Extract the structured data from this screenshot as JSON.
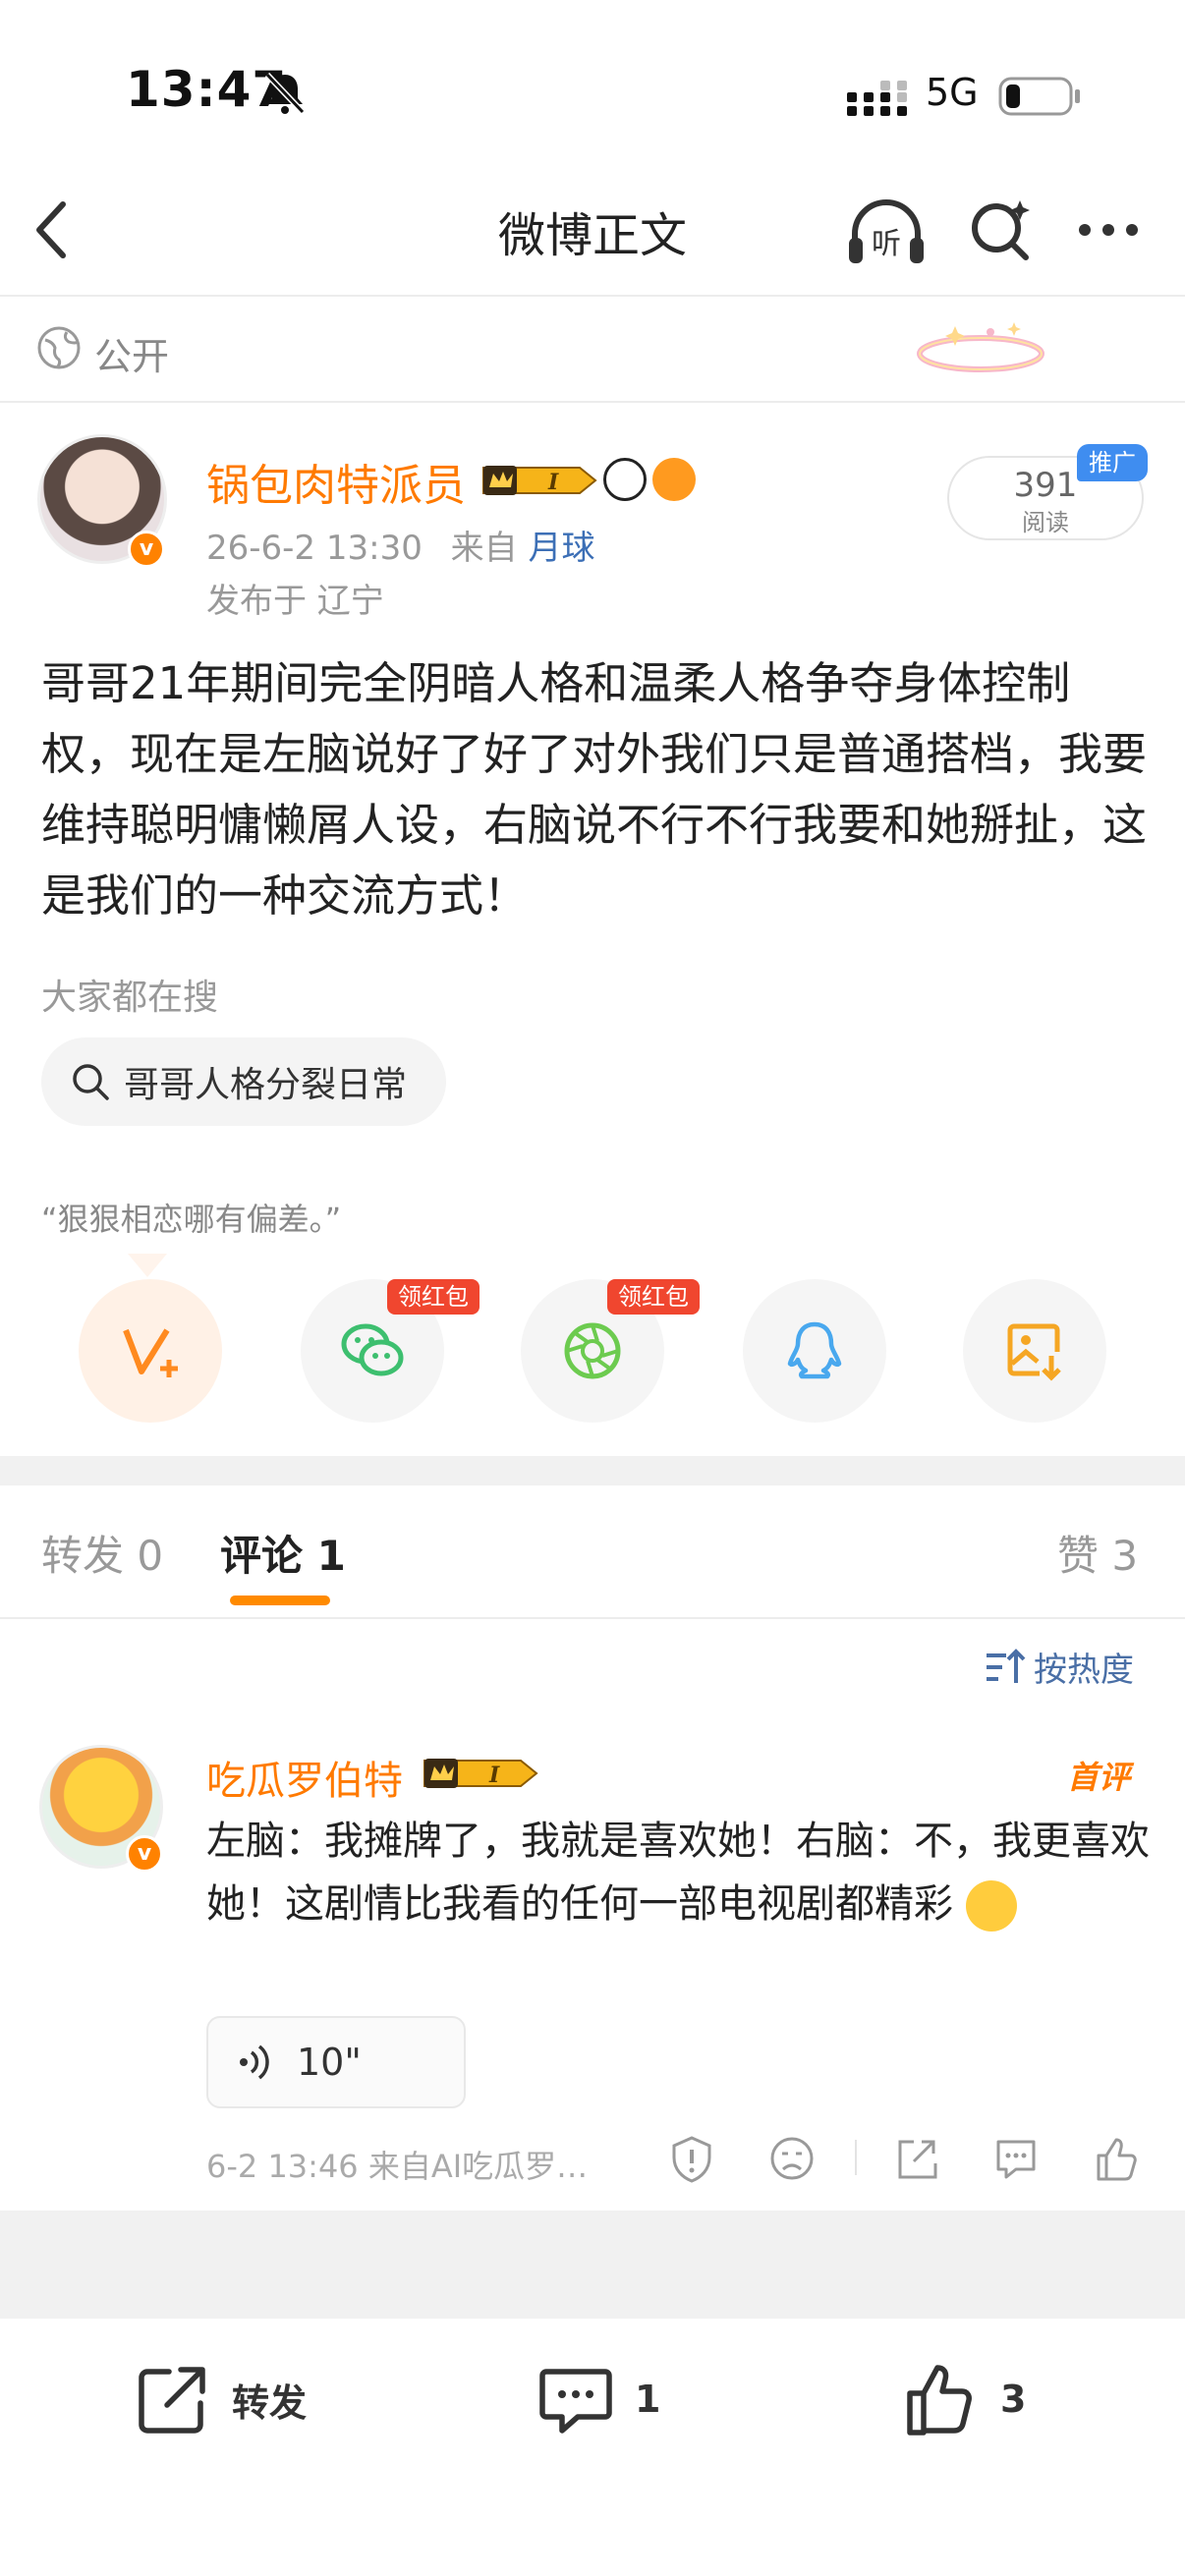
{
  "status_bar": {
    "time": "13:47",
    "network": "5G"
  },
  "nav": {
    "title": "微博正文",
    "listen_label": "听"
  },
  "visibility": {
    "label": "公开"
  },
  "post": {
    "author": "锅包肉特派员",
    "level_badge": "I",
    "date": "26-6-2 13:30",
    "source_prefix": "来自",
    "source": "月球",
    "location": "发布于 辽宁",
    "reads_count": "391",
    "reads_label": "阅读",
    "promo_label": "推广",
    "body": "哥哥21年期间完全阴暗人格和温柔人格争夺身体控制权，现在是左脑说好了好了对外我们只是普通搭档，我要维持聪明慵懒屑人设，右脑说不行不行我要和她掰扯，这是我们的一种交流方式！",
    "hot_search_label": "大家都在搜",
    "hot_search_term": "哥哥人格分裂日常",
    "quote": "“狠狠相恋哪有偏差。”"
  },
  "share": {
    "redpack_label": "领红包",
    "items": [
      "vplus-icon",
      "wechat-icon",
      "moments-icon",
      "qq-icon",
      "save-image-icon"
    ]
  },
  "tabs": {
    "forward_label": "转发",
    "forward_count": "0",
    "comment_label": "评论",
    "comment_count": "1",
    "like_label": "赞",
    "like_count": "3"
  },
  "sort": {
    "label": "按热度"
  },
  "comment": {
    "author": "吃瓜罗伯特",
    "level_badge": "I",
    "first_tag": "首评",
    "text": "左脑：我摊牌了，我就是喜欢她！右脑：不，我更喜欢她！这剧情比我看的任何一部电视剧都精彩",
    "voice_duration": "10\"",
    "meta": "6-2 13:46  来自AI吃瓜罗…"
  },
  "bottom_bar": {
    "forward_label": "转发",
    "comment_count": "1",
    "like_count": "3"
  },
  "colors": {
    "accent": "#ff8200",
    "link": "#3c6fb6",
    "redpack": "#f0462f"
  }
}
